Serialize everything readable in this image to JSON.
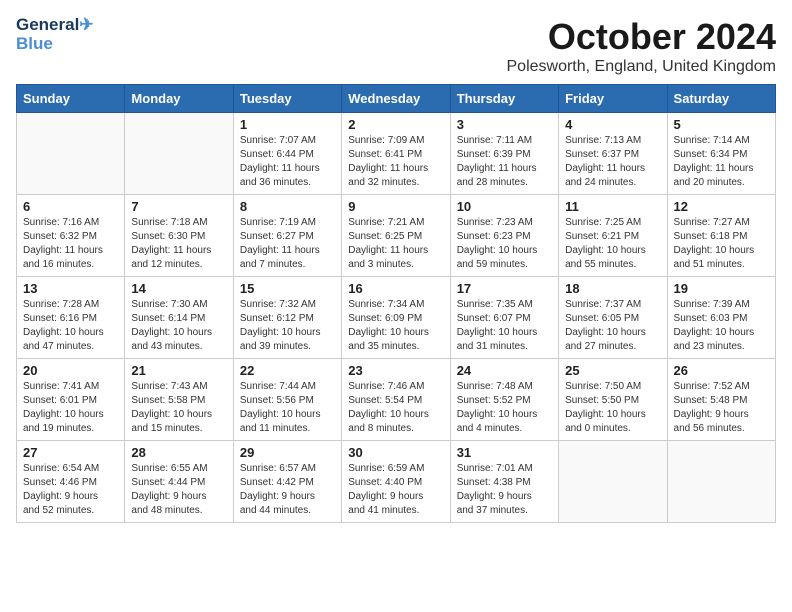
{
  "header": {
    "logo_line1": "General",
    "logo_line2": "Blue",
    "month_title": "October 2024",
    "location": "Polesworth, England, United Kingdom"
  },
  "weekdays": [
    "Sunday",
    "Monday",
    "Tuesday",
    "Wednesday",
    "Thursday",
    "Friday",
    "Saturday"
  ],
  "weeks": [
    [
      {
        "day": "",
        "info": ""
      },
      {
        "day": "",
        "info": ""
      },
      {
        "day": "1",
        "info": "Sunrise: 7:07 AM\nSunset: 6:44 PM\nDaylight: 11 hours\nand 36 minutes."
      },
      {
        "day": "2",
        "info": "Sunrise: 7:09 AM\nSunset: 6:41 PM\nDaylight: 11 hours\nand 32 minutes."
      },
      {
        "day": "3",
        "info": "Sunrise: 7:11 AM\nSunset: 6:39 PM\nDaylight: 11 hours\nand 28 minutes."
      },
      {
        "day": "4",
        "info": "Sunrise: 7:13 AM\nSunset: 6:37 PM\nDaylight: 11 hours\nand 24 minutes."
      },
      {
        "day": "5",
        "info": "Sunrise: 7:14 AM\nSunset: 6:34 PM\nDaylight: 11 hours\nand 20 minutes."
      }
    ],
    [
      {
        "day": "6",
        "info": "Sunrise: 7:16 AM\nSunset: 6:32 PM\nDaylight: 11 hours\nand 16 minutes."
      },
      {
        "day": "7",
        "info": "Sunrise: 7:18 AM\nSunset: 6:30 PM\nDaylight: 11 hours\nand 12 minutes."
      },
      {
        "day": "8",
        "info": "Sunrise: 7:19 AM\nSunset: 6:27 PM\nDaylight: 11 hours\nand 7 minutes."
      },
      {
        "day": "9",
        "info": "Sunrise: 7:21 AM\nSunset: 6:25 PM\nDaylight: 11 hours\nand 3 minutes."
      },
      {
        "day": "10",
        "info": "Sunrise: 7:23 AM\nSunset: 6:23 PM\nDaylight: 10 hours\nand 59 minutes."
      },
      {
        "day": "11",
        "info": "Sunrise: 7:25 AM\nSunset: 6:21 PM\nDaylight: 10 hours\nand 55 minutes."
      },
      {
        "day": "12",
        "info": "Sunrise: 7:27 AM\nSunset: 6:18 PM\nDaylight: 10 hours\nand 51 minutes."
      }
    ],
    [
      {
        "day": "13",
        "info": "Sunrise: 7:28 AM\nSunset: 6:16 PM\nDaylight: 10 hours\nand 47 minutes."
      },
      {
        "day": "14",
        "info": "Sunrise: 7:30 AM\nSunset: 6:14 PM\nDaylight: 10 hours\nand 43 minutes."
      },
      {
        "day": "15",
        "info": "Sunrise: 7:32 AM\nSunset: 6:12 PM\nDaylight: 10 hours\nand 39 minutes."
      },
      {
        "day": "16",
        "info": "Sunrise: 7:34 AM\nSunset: 6:09 PM\nDaylight: 10 hours\nand 35 minutes."
      },
      {
        "day": "17",
        "info": "Sunrise: 7:35 AM\nSunset: 6:07 PM\nDaylight: 10 hours\nand 31 minutes."
      },
      {
        "day": "18",
        "info": "Sunrise: 7:37 AM\nSunset: 6:05 PM\nDaylight: 10 hours\nand 27 minutes."
      },
      {
        "day": "19",
        "info": "Sunrise: 7:39 AM\nSunset: 6:03 PM\nDaylight: 10 hours\nand 23 minutes."
      }
    ],
    [
      {
        "day": "20",
        "info": "Sunrise: 7:41 AM\nSunset: 6:01 PM\nDaylight: 10 hours\nand 19 minutes."
      },
      {
        "day": "21",
        "info": "Sunrise: 7:43 AM\nSunset: 5:58 PM\nDaylight: 10 hours\nand 15 minutes."
      },
      {
        "day": "22",
        "info": "Sunrise: 7:44 AM\nSunset: 5:56 PM\nDaylight: 10 hours\nand 11 minutes."
      },
      {
        "day": "23",
        "info": "Sunrise: 7:46 AM\nSunset: 5:54 PM\nDaylight: 10 hours\nand 8 minutes."
      },
      {
        "day": "24",
        "info": "Sunrise: 7:48 AM\nSunset: 5:52 PM\nDaylight: 10 hours\nand 4 minutes."
      },
      {
        "day": "25",
        "info": "Sunrise: 7:50 AM\nSunset: 5:50 PM\nDaylight: 10 hours\nand 0 minutes."
      },
      {
        "day": "26",
        "info": "Sunrise: 7:52 AM\nSunset: 5:48 PM\nDaylight: 9 hours\nand 56 minutes."
      }
    ],
    [
      {
        "day": "27",
        "info": "Sunrise: 6:54 AM\nSunset: 4:46 PM\nDaylight: 9 hours\nand 52 minutes."
      },
      {
        "day": "28",
        "info": "Sunrise: 6:55 AM\nSunset: 4:44 PM\nDaylight: 9 hours\nand 48 minutes."
      },
      {
        "day": "29",
        "info": "Sunrise: 6:57 AM\nSunset: 4:42 PM\nDaylight: 9 hours\nand 44 minutes."
      },
      {
        "day": "30",
        "info": "Sunrise: 6:59 AM\nSunset: 4:40 PM\nDaylight: 9 hours\nand 41 minutes."
      },
      {
        "day": "31",
        "info": "Sunrise: 7:01 AM\nSunset: 4:38 PM\nDaylight: 9 hours\nand 37 minutes."
      },
      {
        "day": "",
        "info": ""
      },
      {
        "day": "",
        "info": ""
      }
    ]
  ]
}
